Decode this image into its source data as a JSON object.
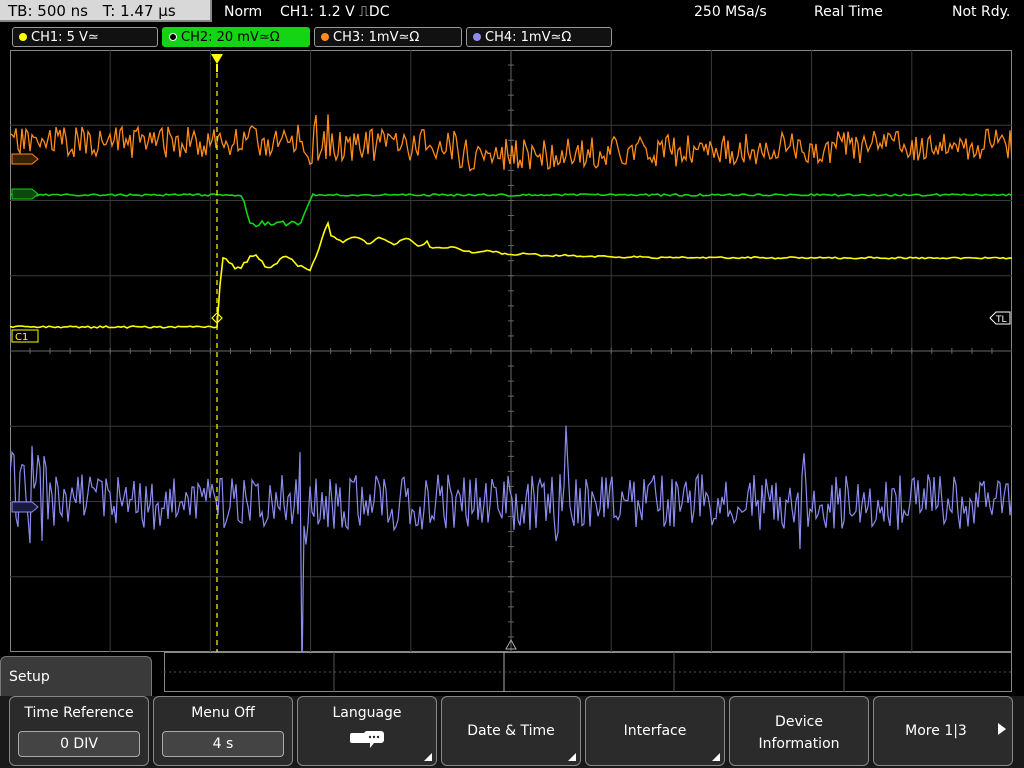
{
  "topbar": {
    "timebase": "TB: 500 ns",
    "trigger_time": "T: 1.47 µs",
    "mode": "Norm",
    "trigger_info": "CH1: 1.2 V ⎍DC",
    "sample_rate": "250 MSa/s",
    "acq_mode": "Real Time",
    "status": "Not Rdy."
  },
  "channels": [
    {
      "label": "CH1: 5 V≃",
      "color": "#ffff00",
      "active": false
    },
    {
      "label": "CH2: 20 mV≃Ω",
      "color": "#14d414",
      "active": true
    },
    {
      "label": "CH3: 1mV≃Ω",
      "color": "#ff8c1a",
      "active": false
    },
    {
      "label": "CH4: 1mV≃Ω",
      "color": "#8c8cf0",
      "active": false
    }
  ],
  "markers": {
    "c1": "C1",
    "tl": "TL"
  },
  "menu": {
    "title": "Setup"
  },
  "softkeys": {
    "time_reference": {
      "label": "Time Reference",
      "value": "0 DIV"
    },
    "menu_off": {
      "label": "Menu Off",
      "value": "4 s"
    },
    "language": {
      "label": "Language",
      "icon": "speech-bubbles-icon"
    },
    "date_time": {
      "label": "Date & Time"
    },
    "interface": {
      "label": "Interface"
    },
    "device_info": {
      "line1": "Device",
      "line2": "Information"
    },
    "more": {
      "label": "More 1|3"
    }
  },
  "colors": {
    "ch1": "#ffff00",
    "ch2": "#14d414",
    "ch3": "#ff8c1a",
    "ch4": "#8c8cf0",
    "grid": "#555555"
  }
}
